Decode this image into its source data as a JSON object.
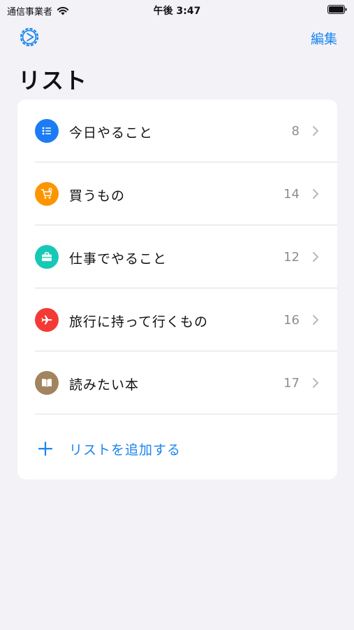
{
  "status_bar": {
    "carrier": "通信事業者",
    "time": "午後 3:47"
  },
  "nav": {
    "edit_label": "編集"
  },
  "title": "リスト",
  "lists": [
    {
      "label": "今日やること",
      "count": "8",
      "icon": "list-bullet-icon",
      "color": "#1b7cf5"
    },
    {
      "label": "買うもの",
      "count": "14",
      "icon": "cart-icon",
      "color": "#fd9500"
    },
    {
      "label": "仕事でやること",
      "count": "12",
      "icon": "briefcase-icon",
      "color": "#16c9b6"
    },
    {
      "label": "旅行に持って行くもの",
      "count": "16",
      "icon": "airplane-icon",
      "color": "#f43a34"
    },
    {
      "label": "読みたい本",
      "count": "17",
      "icon": "book-icon",
      "color": "#a2845e"
    }
  ],
  "add_list_label": "リストを追加する",
  "accent_color": "#1a84f0"
}
